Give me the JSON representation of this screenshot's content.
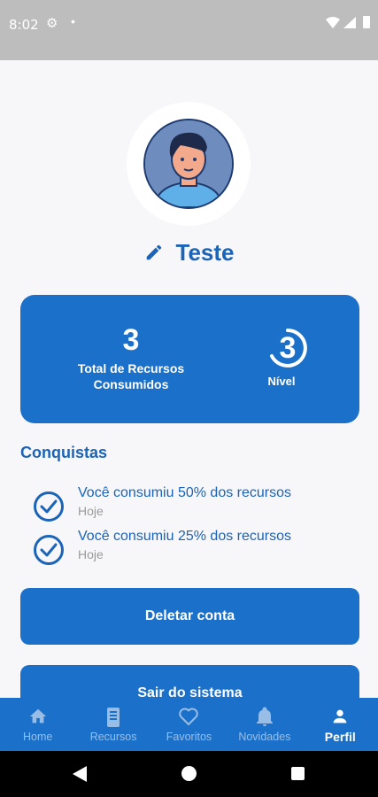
{
  "status_bar": {
    "time": "8:02",
    "icons": [
      "gear-icon",
      "dot-icon",
      "wifi-icon",
      "cellular-icon",
      "battery-icon"
    ]
  },
  "profile": {
    "name": "Teste",
    "edit_icon": "pencil-icon",
    "avatar": "user-avatar-illustration"
  },
  "stats": {
    "total_resources_value": "3",
    "total_resources_label": "Total de Recursos Consumidos",
    "level_value": "3",
    "level_label": "Nível"
  },
  "achievements": {
    "title": "Conquistas",
    "items": [
      {
        "title": "Você consumiu 50% dos recursos",
        "date": "Hoje",
        "icon": "check-circle-icon"
      },
      {
        "title": "Você consumiu 25% dos recursos",
        "date": "Hoje",
        "icon": "check-circle-icon"
      }
    ]
  },
  "actions": {
    "delete_label": "Deletar conta",
    "exit_label": "Sair do sistema"
  },
  "bottom_nav": {
    "items": [
      {
        "label": "Home",
        "icon": "home-icon",
        "active": false
      },
      {
        "label": "Recursos",
        "icon": "phone-icon",
        "active": false
      },
      {
        "label": "Favoritos",
        "icon": "heart-icon",
        "active": false
      },
      {
        "label": "Novidades",
        "icon": "bell-icon",
        "active": false
      },
      {
        "label": "Perfil",
        "icon": "person-icon",
        "active": true
      }
    ]
  },
  "colors": {
    "primary": "#1b70c9",
    "title_blue": "#1b64b8",
    "muted": "#9a9a9a",
    "background": "#f7f7f9"
  }
}
